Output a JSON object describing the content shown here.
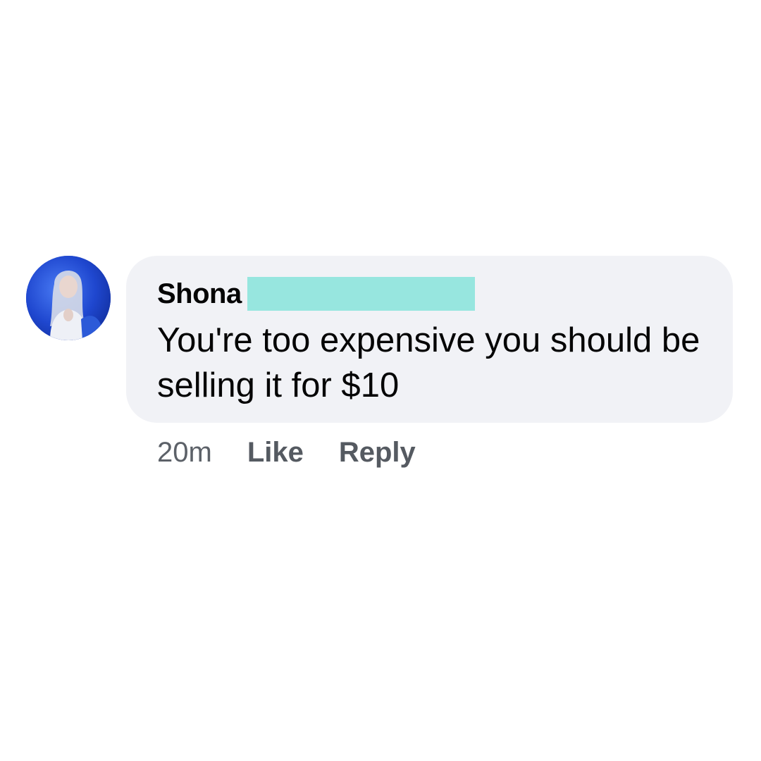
{
  "comment": {
    "author": "Shona",
    "text": "You're too expensive you should be selling it for $10",
    "timestamp": "20m",
    "like_label": "Like",
    "reply_label": "Reply",
    "redaction_color": "#97e6df",
    "bubble_color": "#f1f2f6"
  }
}
